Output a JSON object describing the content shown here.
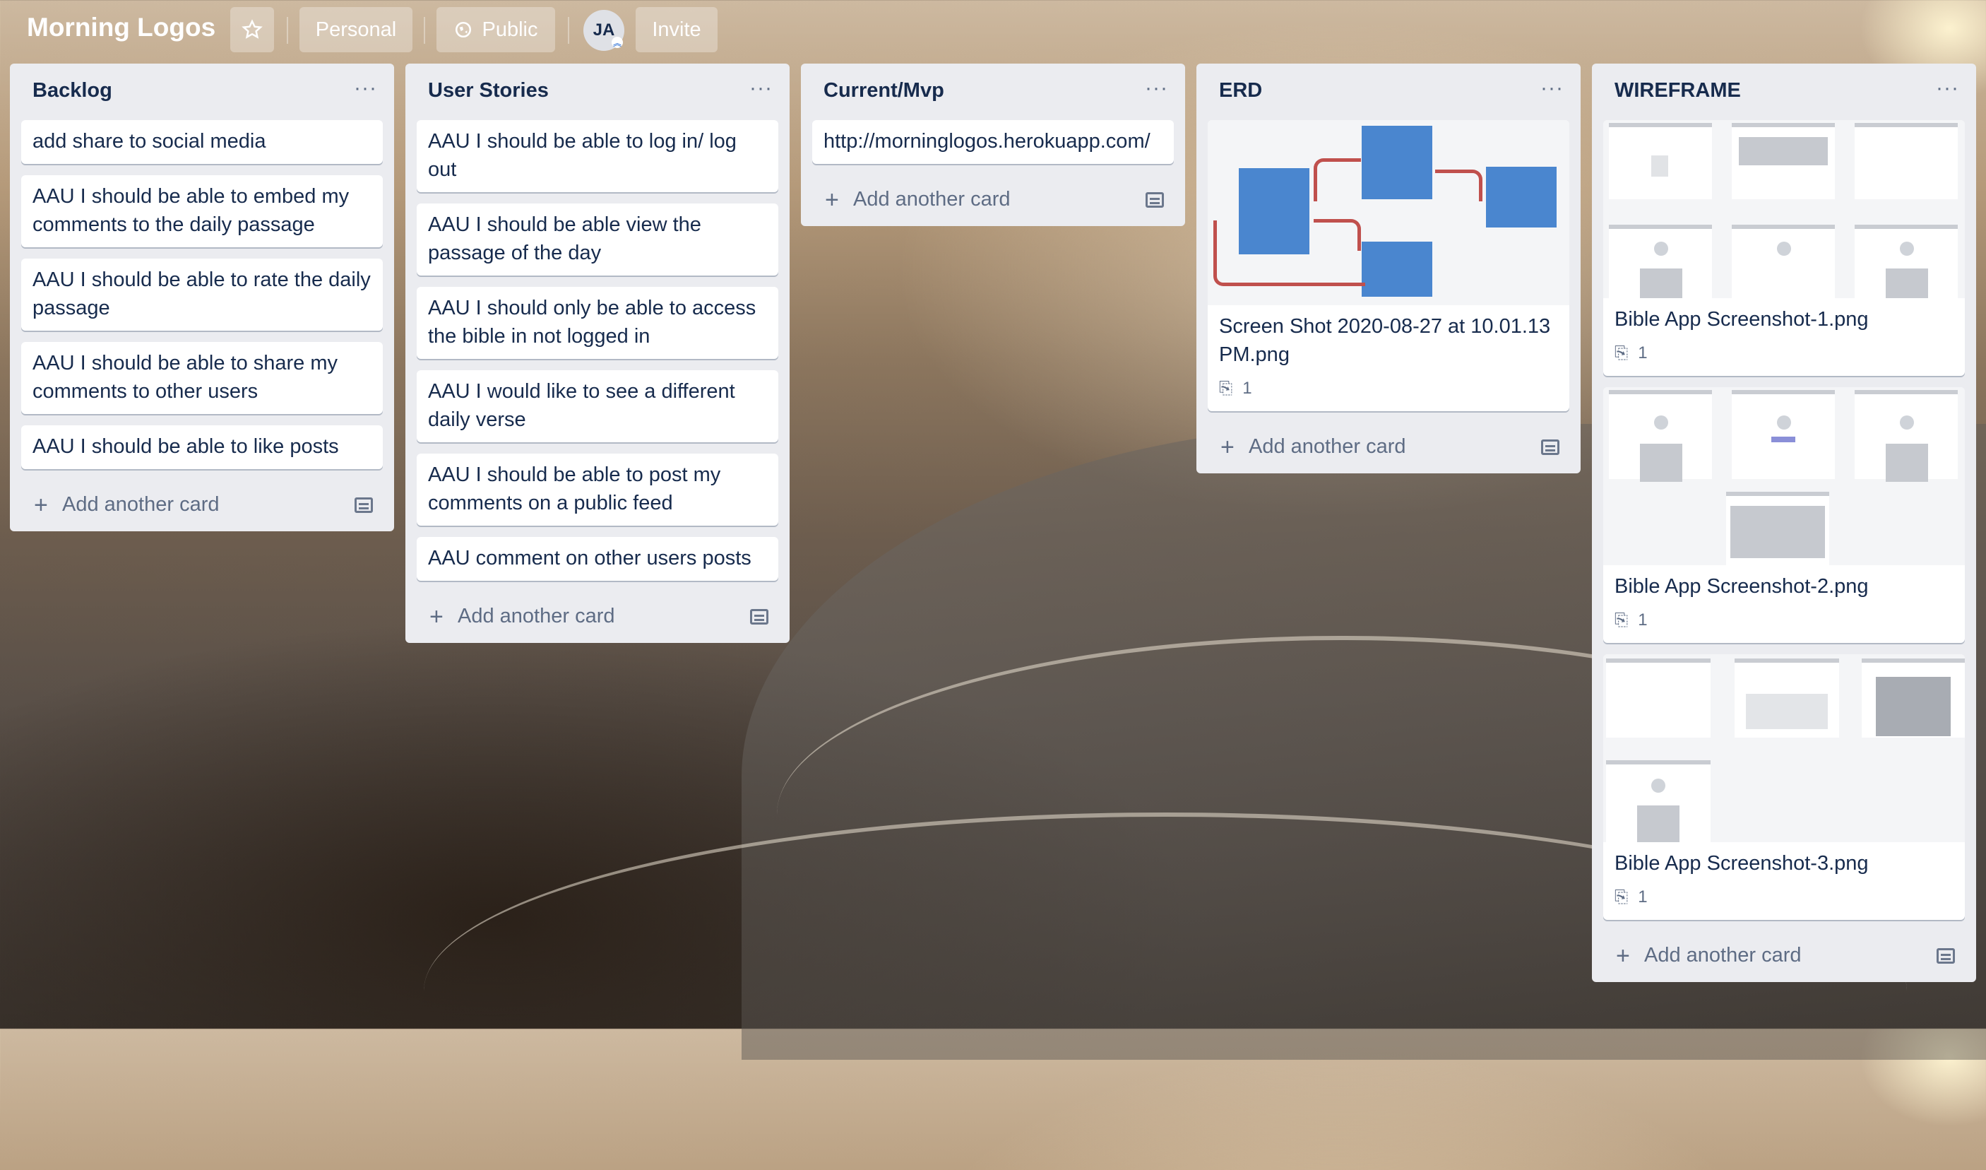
{
  "header": {
    "board_title": "Morning Logos",
    "star_icon": "star-icon",
    "personal_label": "Personal",
    "public_label": "Public",
    "avatar_initials": "JA",
    "invite_label": "Invite"
  },
  "lists": [
    {
      "title": "Backlog",
      "cards": [
        "add share to social media",
        "AAU I should be able to embed my comments to the daily passage",
        "AAU I should be able to rate the daily passage",
        "AAU I should be able to share my comments to other users",
        "AAU I should be able to like posts"
      ],
      "add_label": "Add another card"
    },
    {
      "title": "User Stories",
      "cards": [
        "AAU I should be able to log in/ log out",
        "AAU I should be able view the passage of the day",
        "AAU I should only be able to access the bible in not logged in",
        "AAU I would like to see a different daily verse",
        "AAU I should be able to post my comments on a public feed",
        "AAU comment on other users posts"
      ],
      "add_label": "Add another card"
    },
    {
      "title": "Current/Mvp",
      "cards": [
        "http://morninglogos.herokuapp.com/"
      ],
      "add_label": "Add another card"
    },
    {
      "title": "ERD",
      "image_cards": [
        {
          "title": "Screen Shot 2020-08-27 at 10.01.13 PM.png",
          "attachments": "1"
        }
      ],
      "add_label": "Add another card"
    },
    {
      "title": "WIREFRAME",
      "image_cards": [
        {
          "title": "Bible App Screenshot-1.png",
          "attachments": "1"
        },
        {
          "title": "Bible App Screenshot-2.png",
          "attachments": "1"
        },
        {
          "title": "Bible App Screenshot-3.png",
          "attachments": "1"
        }
      ],
      "add_label": "Add another card"
    }
  ],
  "list_menu_glyph": "···",
  "colors": {
    "list_bg": "#ebecf0",
    "card_text": "#172b4d",
    "muted": "#5e6c84"
  }
}
